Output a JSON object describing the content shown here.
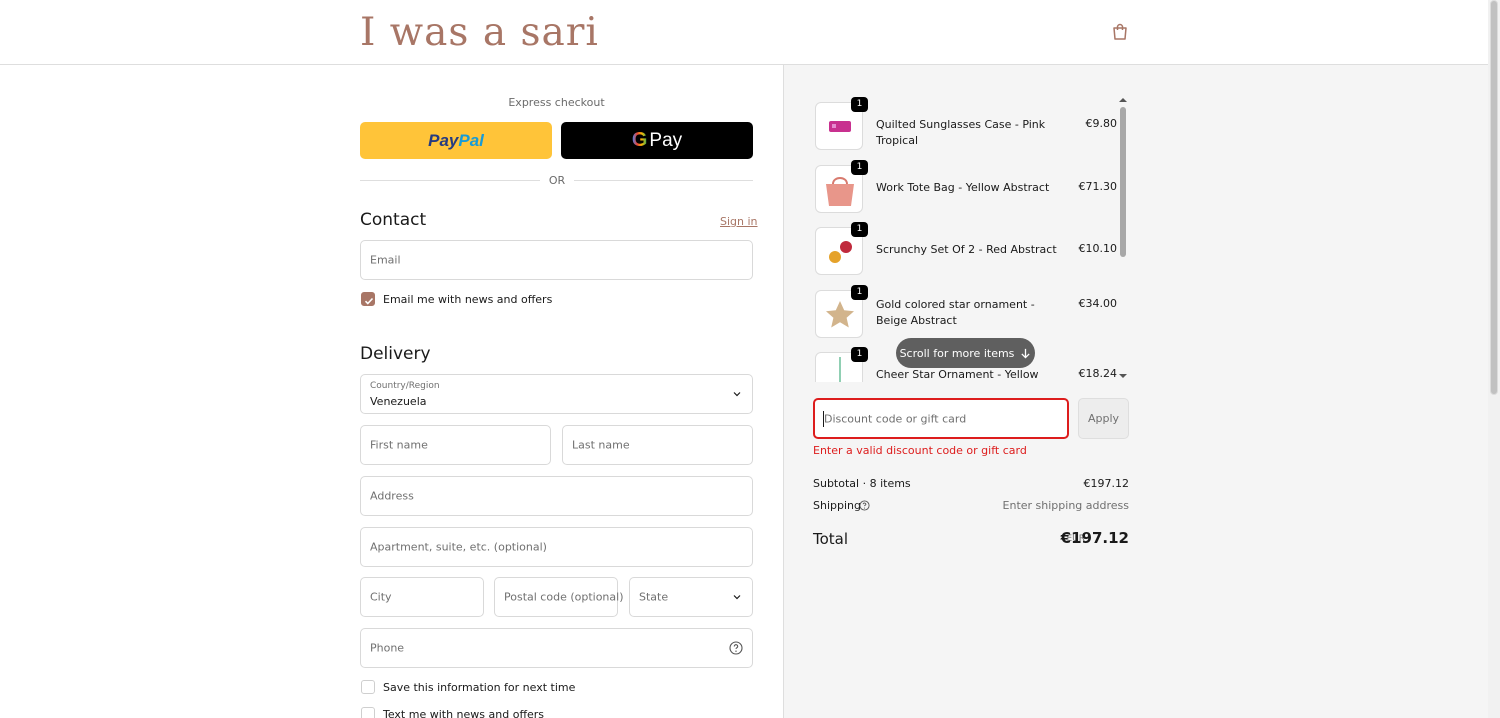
{
  "header": {
    "logo_text": "I was a sari",
    "cart_icon": "shopping-bag-icon"
  },
  "express": {
    "label": "Express checkout",
    "paypal_pay": "Pay",
    "paypal_pal": "Pal",
    "gpay_g": "G",
    "gpay_label": "Pay",
    "or_text": "OR"
  },
  "contact": {
    "title": "Contact",
    "sign_in": "Sign in",
    "email_placeholder": "Email",
    "newsletter_label": "Email me with news and offers",
    "newsletter_checked": true
  },
  "delivery": {
    "title": "Delivery",
    "country_label": "Country/Region",
    "country_value": "Venezuela",
    "first_name": "First name",
    "last_name": "Last name",
    "address": "Address",
    "apartment": "Apartment, suite, etc. (optional)",
    "city": "City",
    "postal": "Postal code (optional)",
    "state": "State",
    "phone": "Phone",
    "save_info": "Save this information for next time",
    "text_me": "Text me with news and offers"
  },
  "order": {
    "items": [
      {
        "qty": "1",
        "name": "Quilted Sunglasses Case - Pink Tropical",
        "price": "€9.80"
      },
      {
        "qty": "1",
        "name": "Work Tote Bag - Yellow Abstract",
        "price": "€71.30"
      },
      {
        "qty": "1",
        "name": "Scrunchy Set Of 2 - Red Abstract",
        "price": "€10.10"
      },
      {
        "qty": "1",
        "name": "Gold colored star ornament - Beige Abstract",
        "price": "€34.00"
      },
      {
        "qty": "1",
        "name": "Cheer Star Ornament - Yellow Abstract",
        "price": "€18.24"
      }
    ],
    "scroll_hint": "Scroll for more items",
    "discount_placeholder": "Discount code or gift card",
    "apply": "Apply",
    "error": "Enter a valid discount code or gift card",
    "subtotal_label": "Subtotal · 8 items",
    "subtotal_value": "€197.12",
    "shipping_label": "Shipping",
    "shipping_value": "Enter shipping address",
    "total_label": "Total",
    "currency": "EUR",
    "total_value": "€197.12"
  },
  "colors": {
    "accent": "#a87666",
    "error": "#dd1d1d",
    "paypal": "#ffc439"
  }
}
